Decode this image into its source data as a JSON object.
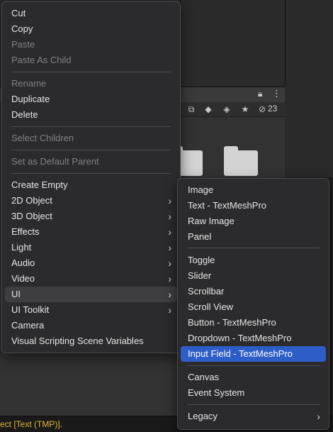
{
  "main_menu": {
    "items": [
      {
        "label": "Cut",
        "enabled": true
      },
      {
        "label": "Copy",
        "enabled": true
      },
      {
        "label": "Paste",
        "enabled": false
      },
      {
        "label": "Paste As Child",
        "enabled": false
      },
      {
        "label": "Rename",
        "enabled": false
      },
      {
        "label": "Duplicate",
        "enabled": true
      },
      {
        "label": "Delete",
        "enabled": true
      },
      {
        "label": "Select Children",
        "enabled": false
      },
      {
        "label": "Set as Default Parent",
        "enabled": false
      },
      {
        "label": "Create Empty",
        "enabled": true
      },
      {
        "label": "2D Object",
        "enabled": true,
        "submenu": true
      },
      {
        "label": "3D Object",
        "enabled": true,
        "submenu": true
      },
      {
        "label": "Effects",
        "enabled": true,
        "submenu": true
      },
      {
        "label": "Light",
        "enabled": true,
        "submenu": true
      },
      {
        "label": "Audio",
        "enabled": true,
        "submenu": true
      },
      {
        "label": "Video",
        "enabled": true,
        "submenu": true
      },
      {
        "label": "UI",
        "enabled": true,
        "submenu": true,
        "highlighted": true
      },
      {
        "label": "UI Toolkit",
        "enabled": true,
        "submenu": true
      },
      {
        "label": "Camera",
        "enabled": true
      },
      {
        "label": "Visual Scripting Scene Variables",
        "enabled": true
      }
    ],
    "arrow_glyph": "›"
  },
  "ui_submenu": {
    "items": [
      {
        "label": "Image"
      },
      {
        "label": "Text - TextMeshPro"
      },
      {
        "label": "Raw Image"
      },
      {
        "label": "Panel"
      },
      {
        "label": "Toggle"
      },
      {
        "label": "Slider"
      },
      {
        "label": "Scrollbar"
      },
      {
        "label": "Scroll View"
      },
      {
        "label": "Button - TextMeshPro"
      },
      {
        "label": "Dropdown - TextMeshPro"
      },
      {
        "label": "Input Field - TextMeshPro",
        "selected": true
      },
      {
        "label": "Canvas"
      },
      {
        "label": "Event System"
      },
      {
        "label": "Legacy",
        "submenu": true
      }
    ]
  },
  "project_panel": {
    "hidden_count": "23",
    "toolbar_icons": [
      "scene-icon",
      "filter-icon",
      "tag-icon",
      "favorite-icon",
      "visibility-icon"
    ]
  },
  "console": {
    "message": "ect [Text (TMP)]."
  },
  "colors": {
    "selection": "#2d5ec8",
    "menu_bg": "#2b2b2d",
    "console_warning": "#e2b73a"
  }
}
